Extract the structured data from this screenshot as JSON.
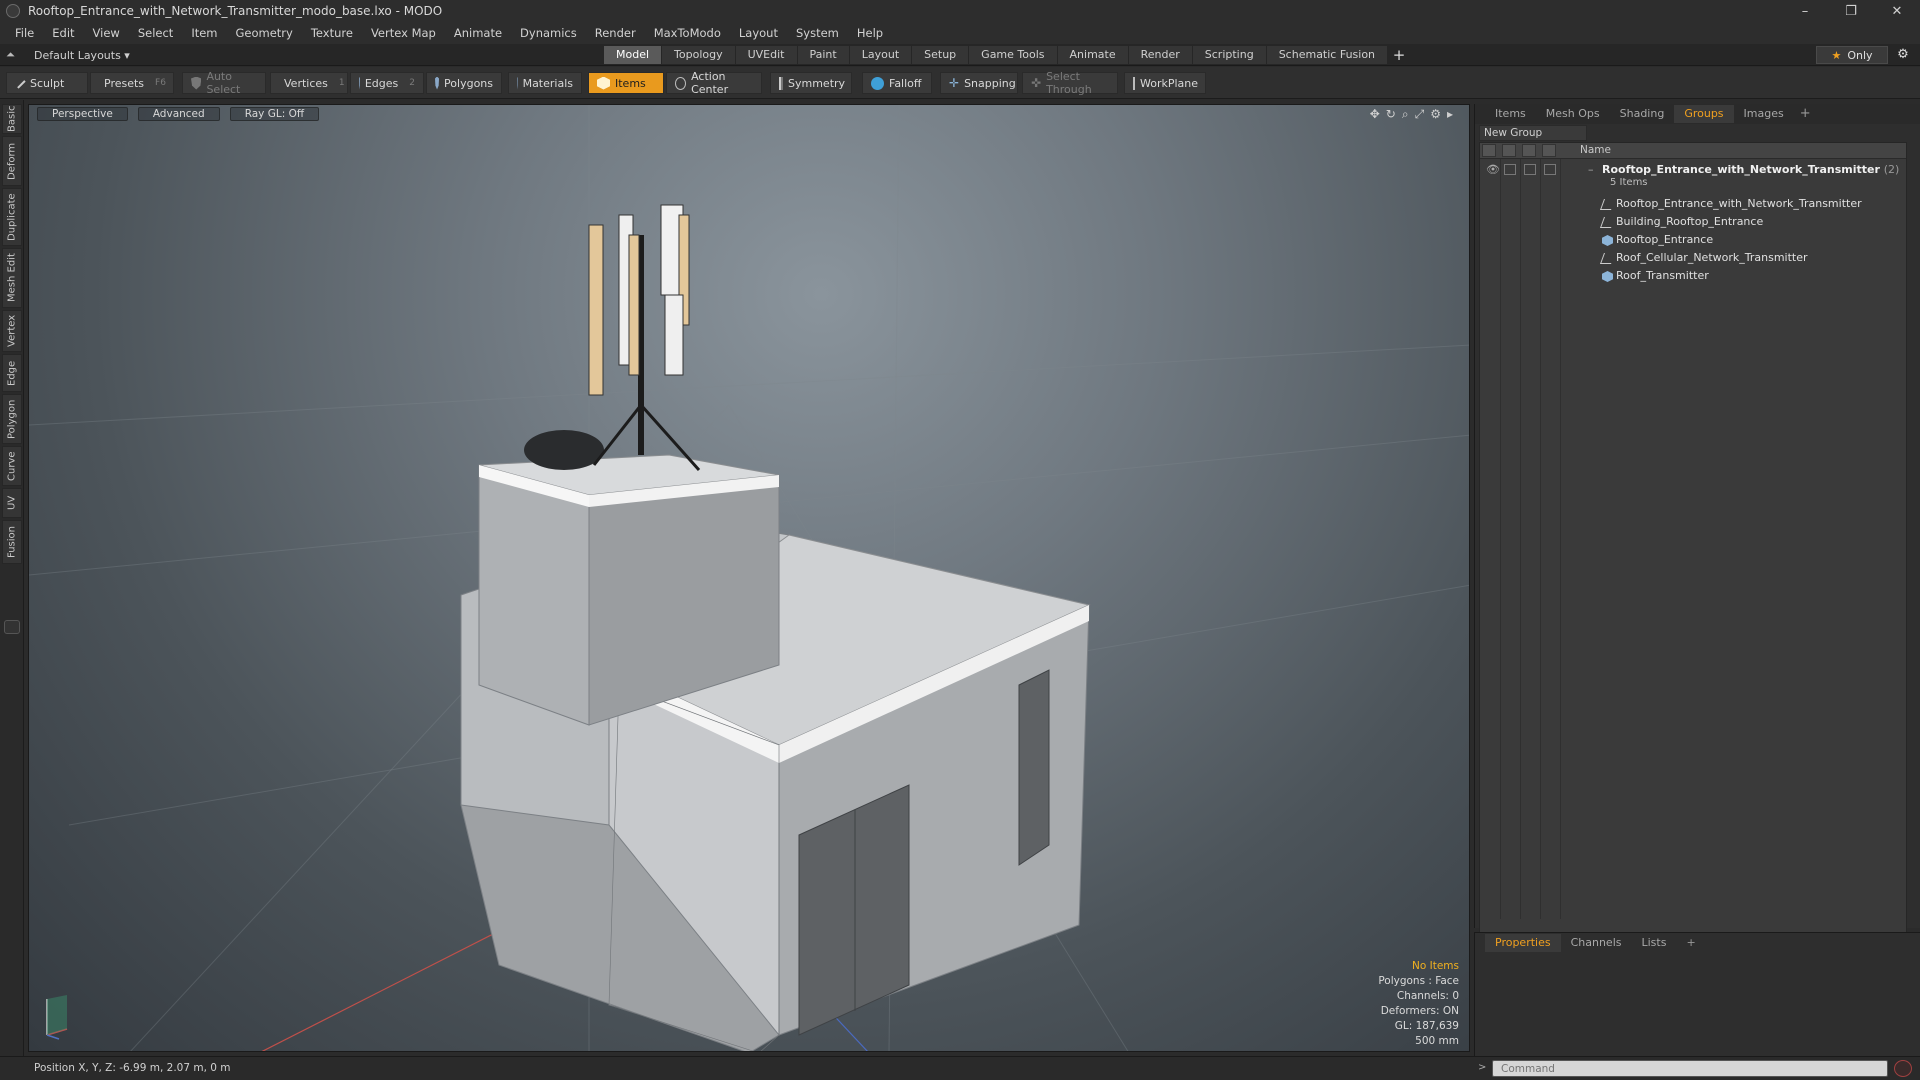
{
  "window": {
    "title": "Rooftop_Entrance_with_Network_Transmitter_modo_base.lxo - MODO",
    "controls": [
      "–",
      "❐",
      "✕"
    ]
  },
  "menu": [
    "File",
    "Edit",
    "View",
    "Select",
    "Item",
    "Geometry",
    "Texture",
    "Vertex Map",
    "Animate",
    "Dynamics",
    "Render",
    "MaxToModo",
    "Layout",
    "System",
    "Help"
  ],
  "layouts": {
    "label": "Default Layouts ▾"
  },
  "mode_tabs": [
    "Model",
    "Topology",
    "UVEdit",
    "Paint",
    "Layout",
    "Setup",
    "Game Tools",
    "Animate",
    "Render",
    "Scripting",
    "Schematic Fusion"
  ],
  "active_mode_tab": "Model",
  "only_button": {
    "label": "Only"
  },
  "toolbar": {
    "sculpt": "Sculpt",
    "presets": "Presets",
    "presets_key": "F6",
    "auto_select": "Auto Select",
    "vertices": "Vertices",
    "vertices_key": "1",
    "edges": "Edges",
    "edges_key": "2",
    "polygons": "Polygons",
    "materials": "Materials",
    "items": "Items",
    "action_center": "Action Center",
    "symmetry": "Symmetry",
    "falloff": "Falloff",
    "snapping": "Snapping",
    "select_through": "Select Through",
    "workplane": "WorkPlane"
  },
  "left_tabs": [
    "Basic",
    "Deform",
    "Duplicate",
    "Mesh Edit",
    "Vertex",
    "Edge",
    "Polygon",
    "Curve",
    "UV",
    "Fusion"
  ],
  "viewport": {
    "buttons": [
      "Perspective",
      "Advanced",
      "Ray GL: Off"
    ],
    "info": {
      "selection": "No Items",
      "polygons": "Polygons : Face",
      "channels": "Channels: 0",
      "deformers": "Deformers: ON",
      "gl": "GL: 187,639",
      "scale": "500 mm"
    }
  },
  "right_panel": {
    "tabs": [
      "Items",
      "Mesh Ops",
      "Shading",
      "Groups",
      "Images"
    ],
    "active_tab": "Groups",
    "new_group": "New Group",
    "column_name": "Name",
    "group": {
      "name": "Rooftop_Entrance_with_Network_Transmitter",
      "count": "(2)",
      "sub": "5 Items"
    },
    "items": [
      {
        "name": "Rooftop_Entrance_with_Network_Transmitter",
        "icon": "locator-icon"
      },
      {
        "name": "Building_Rooftop_Entrance",
        "icon": "locator-icon"
      },
      {
        "name": "Rooftop_Entrance",
        "icon": "mesh-icon"
      },
      {
        "name": "Roof_Cellular_Network_Transmitter",
        "icon": "locator-icon"
      },
      {
        "name": "Roof_Transmitter",
        "icon": "mesh-icon"
      }
    ]
  },
  "properties_panel": {
    "tabs": [
      "Properties",
      "Channels",
      "Lists"
    ],
    "active_tab": "Properties"
  },
  "status": {
    "position": "Position X, Y, Z:  -6.99 m, 2.07 m, 0 m",
    "command_placeholder": "Command"
  },
  "colors": {
    "accent": "#e99a1e",
    "panel_bg": "#2e2e2e",
    "active_tab_text": "#f0a020"
  }
}
